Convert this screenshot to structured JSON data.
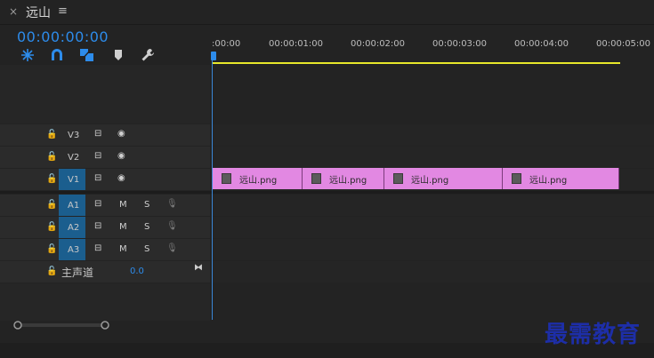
{
  "panel": {
    "close_glyph": "×",
    "title": "远山",
    "menu_glyph": "≡"
  },
  "timecode": "00:00:00:00",
  "tools": [
    "snap-icon",
    "magnet-icon",
    "linked-selection-icon",
    "marker-icon",
    "wrench-icon"
  ],
  "ruler_ticks": [
    ":00:00",
    "00:00:01:00",
    "00:00:02:00",
    "00:00:03:00",
    "00:00:04:00",
    "00:00:05:00"
  ],
  "video_tracks": [
    {
      "name": "V3",
      "selected": false
    },
    {
      "name": "V2",
      "selected": false
    },
    {
      "name": "V1",
      "selected": true
    }
  ],
  "audio_tracks": [
    {
      "name": "A1",
      "m": "M",
      "s": "S"
    },
    {
      "name": "A2",
      "m": "M",
      "s": "S"
    },
    {
      "name": "A3",
      "m": "M",
      "s": "S"
    }
  ],
  "master": {
    "label": "主声道",
    "value": "0.0"
  },
  "clips": [
    {
      "label": "远山.png"
    },
    {
      "label": "远山.png"
    },
    {
      "label": "远山.png"
    },
    {
      "label": "远山.png"
    }
  ],
  "watermark": "最需教育",
  "colors": {
    "accent": "#2d8ceb",
    "clip": "#e288e2",
    "work_area": "#e8e82a",
    "track_select": "#1b5e8e"
  }
}
